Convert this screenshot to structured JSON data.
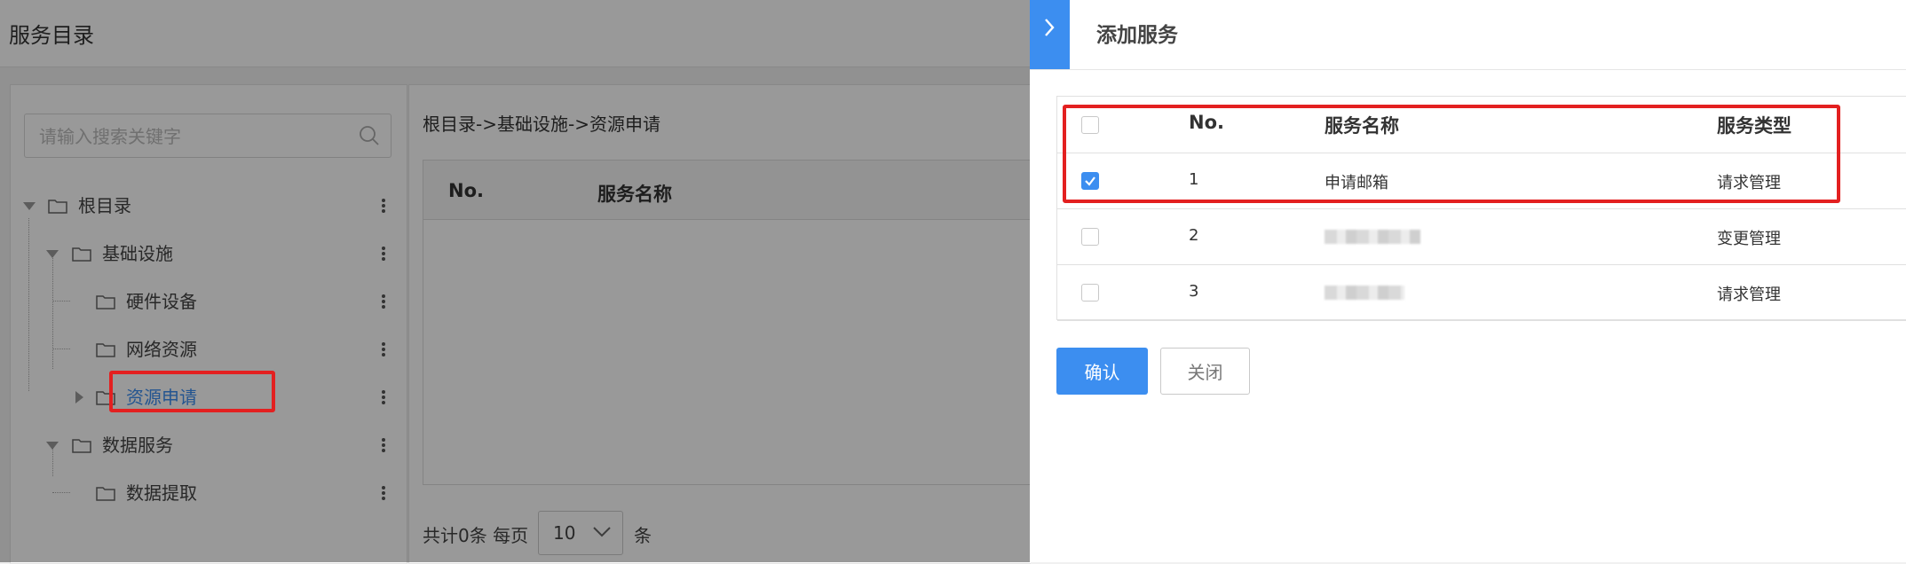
{
  "page": {
    "title": "服务目录"
  },
  "search": {
    "placeholder": "请输入搜索关键字"
  },
  "tree": {
    "root": "根目录",
    "infra": "基础设施",
    "hardware": "硬件设备",
    "network": "网络资源",
    "resource_request": "资源申请",
    "data_service": "数据服务",
    "data_extract": "数据提取"
  },
  "breadcrumb": "根目录->基础设施->资源申请",
  "list_table": {
    "col_no": "No.",
    "col_name": "服务名称"
  },
  "pagination": {
    "total": "共计0条 每页",
    "page_size": "10",
    "unit": "条"
  },
  "drawer": {
    "title": "添加服务",
    "table": {
      "col_no": "No.",
      "col_name": "服务名称",
      "col_type": "服务类型",
      "rows": [
        {
          "no": "1",
          "name": "申请邮箱",
          "type": "请求管理",
          "checked": true
        },
        {
          "no": "2",
          "name": "",
          "type": "变更管理",
          "checked": false
        },
        {
          "no": "3",
          "name": "",
          "type": "请求管理",
          "checked": false
        }
      ]
    },
    "confirm_label": "确认",
    "close_label": "关闭"
  },
  "colors": {
    "accent": "#3c8ef0",
    "highlight": "#e32020"
  }
}
